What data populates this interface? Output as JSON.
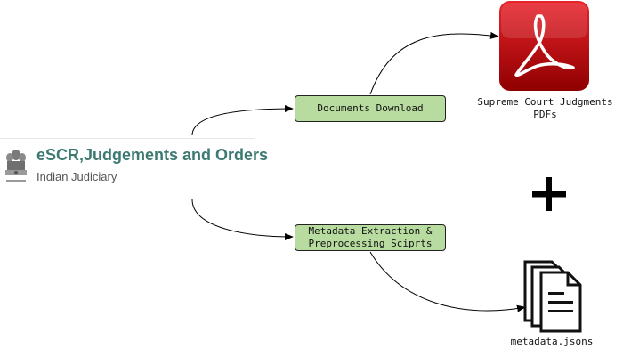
{
  "source": {
    "title": "eSCR,Judgements and Orders",
    "subtitle": "Indian Judiciary",
    "emblem_icon": "national-emblem-icon",
    "title_color": "#3d7a72"
  },
  "steps": {
    "download": {
      "label": "Documents Download"
    },
    "metadata": {
      "line1": "Metadata Extraction &",
      "line2": "Preprocessing Sciprts"
    },
    "box_color": "#b8dba0"
  },
  "outputs": {
    "pdfs": {
      "icon": "adobe-pdf-icon",
      "line1": "Supreme Court Judgments",
      "line2": "PDFs",
      "icon_color": "#c00000"
    },
    "combine": {
      "icon": "plus-icon"
    },
    "json": {
      "icon": "documents-stack-icon",
      "label": "metadata.jsons"
    }
  }
}
